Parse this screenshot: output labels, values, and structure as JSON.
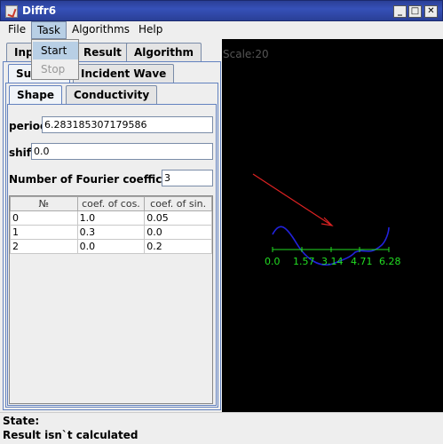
{
  "window": {
    "title": "Diffr6"
  },
  "menu": {
    "file": "File",
    "task": "Task",
    "algorithms": "Algorithms",
    "help": "Help"
  },
  "task_menu": {
    "start": "Start",
    "stop": "Stop"
  },
  "tabs_top": {
    "input": "Input",
    "result": "Result",
    "algorithm": "Algorithm"
  },
  "tabs_mid": {
    "surface": "Surface",
    "incident_wave": "Incident Wave"
  },
  "tabs_inner": {
    "shape": "Shape",
    "conductivity": "Conductivity"
  },
  "shape": {
    "period_label": "period",
    "period_value": "6.283185307179586",
    "shift_label": "shift",
    "shift_value": "0.0",
    "fourier_label": "Number of Fourier coefficients",
    "fourier_value": "3",
    "columns": [
      "№",
      "coef. of cos.",
      "coef. of sin."
    ],
    "rows": [
      [
        "0",
        "1.0",
        "0.05"
      ],
      [
        "1",
        "0.3",
        "0.0"
      ],
      [
        "2",
        "0.0",
        "0.2"
      ]
    ]
  },
  "canvas": {
    "scale_label": "Scale:20",
    "axis_ticks": [
      "0.0",
      "1.57",
      "3.14",
      "4.71",
      "6.28"
    ],
    "colors": {
      "axis": "#22dd22",
      "curve": "#2222dd",
      "arrow": "#dd2222",
      "background": "#000000"
    }
  },
  "status": {
    "state_label": "State:",
    "message": "Result isn`t calculated"
  }
}
